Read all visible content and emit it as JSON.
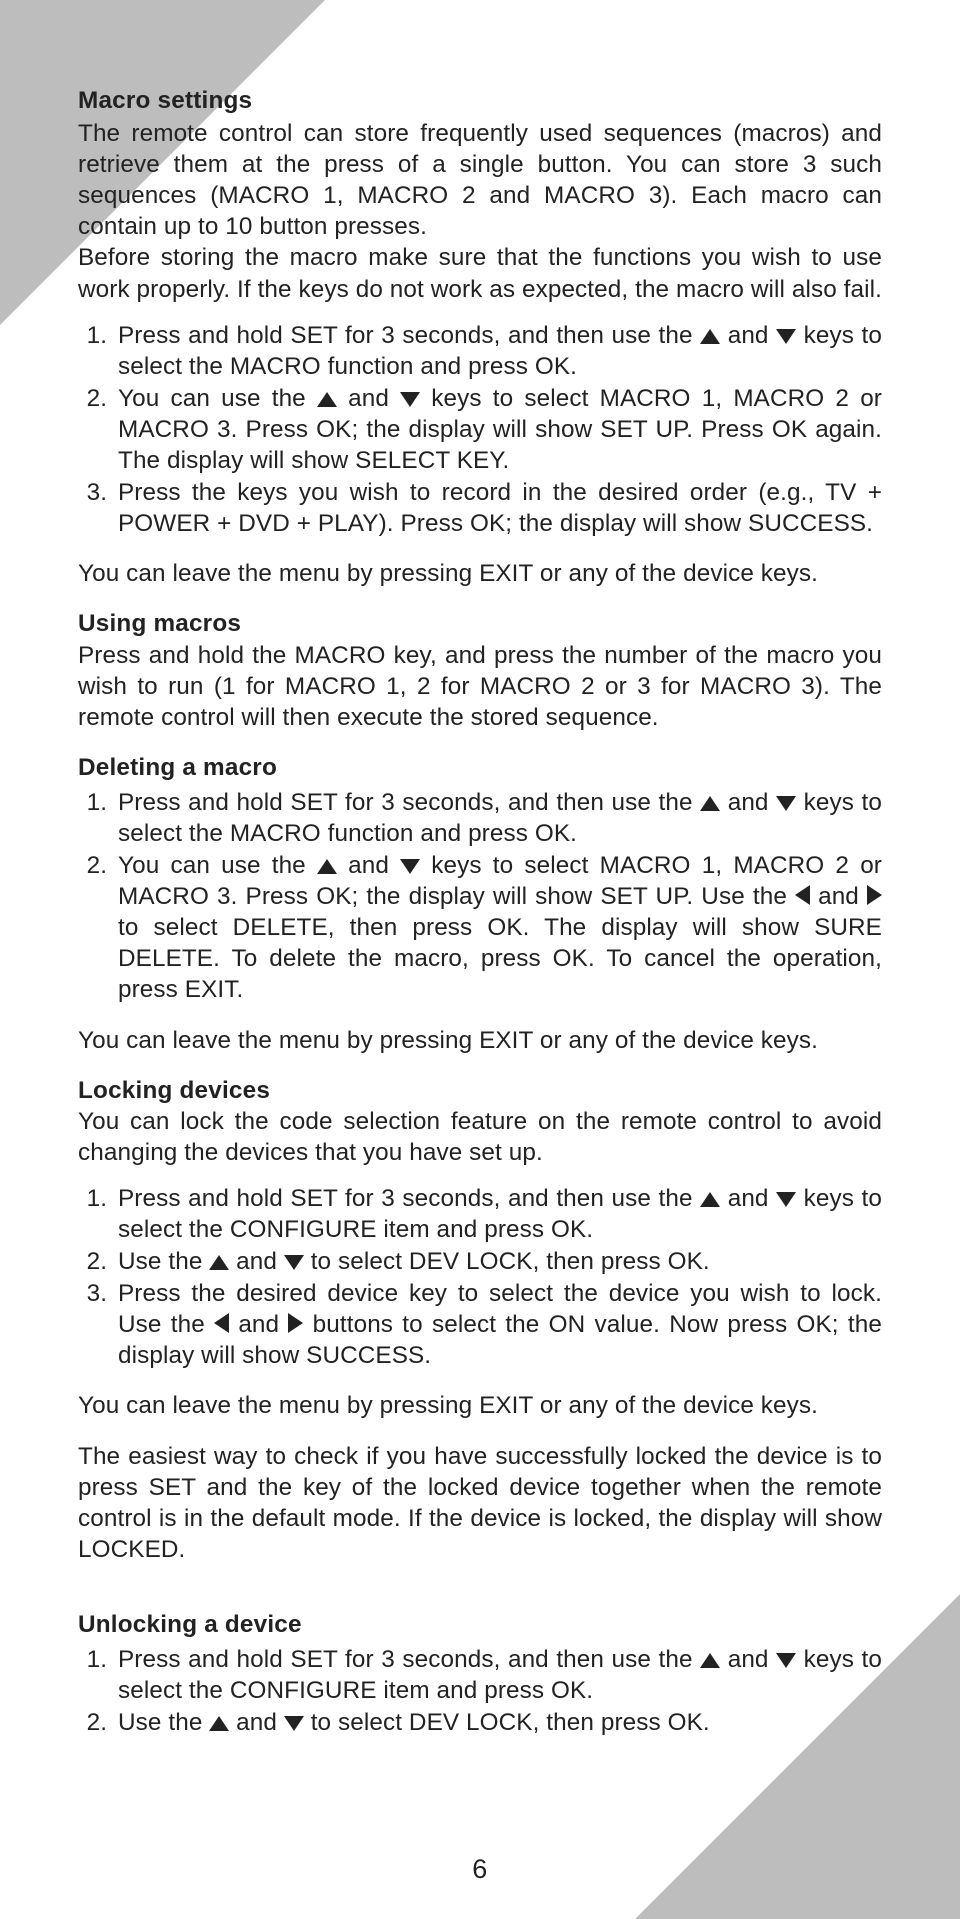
{
  "page_number": "6",
  "sections": {
    "macro_settings": {
      "heading": "Macro settings",
      "intro": "The remote control can store frequently used sequences (macros) and retrieve them at the press of a single button. You can store 3 such sequences (MACRO 1, MACRO 2 and MACRO 3). Each macro can contain up to 10 button presses.",
      "note": "Before storing the macro make sure that the functions you wish to use work properly. If the keys do not work as expected, the macro will also fail.",
      "steps": {
        "s1a": "Press and hold SET for 3 seconds, and then use the ",
        "s1b": " and ",
        "s1c": " keys to select the MACRO function and press OK.",
        "s2a": "You can use the ",
        "s2b": " and ",
        "s2c": " keys to select MACRO 1, MACRO 2 or MACRO 3. Press OK; the display will show SET UP. Press OK again. The display will show SELECT KEY.",
        "s3": "Press the keys you wish to record in the desired order (e.g., TV + POWER + DVD + PLAY). Press OK; the display will show SUCCESS."
      },
      "after": "You can leave the menu by pressing EXIT or any of the device keys."
    },
    "using_macros": {
      "heading": "Using macros",
      "body": "Press and hold the MACRO key, and press the number of the macro you wish to run (1 for MACRO 1, 2 for MACRO 2 or 3 for MACRO 3). The remote control will then execute the stored sequence."
    },
    "deleting": {
      "heading": "Deleting a macro",
      "steps": {
        "s1a": "Press and hold SET for 3 seconds, and then use the ",
        "s1b": " and ",
        "s1c": " keys to select the MACRO function and press OK.",
        "s2a": "You can use the ",
        "s2b": " and ",
        "s2c": " keys to select MACRO 1, MACRO 2 or MACRO 3. Press OK; the display will show SET UP. Use the ",
        "s2d": " and ",
        "s2e": " to select DELETE, then press OK. The display will show SURE DELETE. To delete the macro, press OK. To cancel the operation, press EXIT."
      },
      "after": "You can leave the menu by pressing EXIT or any of the device keys."
    },
    "locking": {
      "heading": "Locking devices",
      "intro": "You can lock the code selection feature on the remote control to avoid changing the devices that you have set up.",
      "steps": {
        "s1a": "Press and hold SET for 3 seconds, and then use the ",
        "s1b": " and ",
        "s1c": " keys to select the CONFIGURE item and press OK.",
        "s2a": "Use the ",
        "s2b": " and ",
        "s2c": " to select DEV LOCK, then press OK.",
        "s3a": "Press the desired device key to select the device you wish to lock. Use the ",
        "s3b": " and ",
        "s3c": " buttons to select the ON value. Now press OK; the display will show SUCCESS."
      },
      "after": "You can leave the menu by pressing EXIT or any of the device keys.",
      "tip": "The easiest way to check if you have successfully locked the device is to press SET and the key of the locked device together when the remote control is in the default mode. If the device is locked, the display will show LOCKED."
    },
    "unlocking": {
      "heading": "Unlocking a device",
      "steps": {
        "s1a": "Press and hold SET for 3 seconds, and then use the ",
        "s1b": " and ",
        "s1c": " keys to select the CONFIGURE item and press OK.",
        "s2a": "Use the ",
        "s2b": " and ",
        "s2c": " to select DEV LOCK, then press OK."
      }
    }
  }
}
